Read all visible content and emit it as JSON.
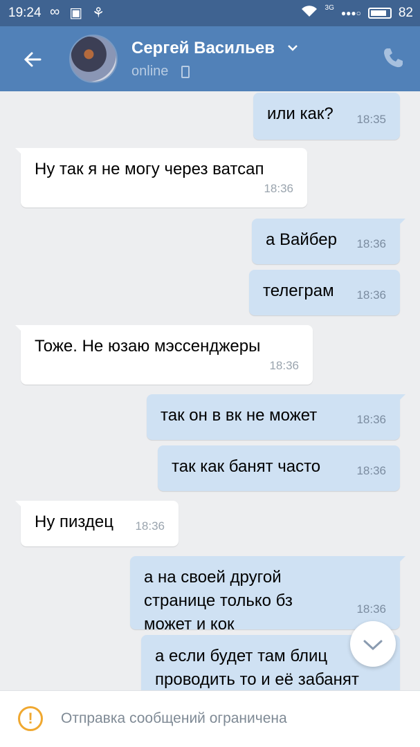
{
  "status_bar": {
    "time": "19:24",
    "battery": "82",
    "network": "3G"
  },
  "header": {
    "contact_name": "Сергей Васильев",
    "status": "online"
  },
  "messages": [
    {
      "dir": "out",
      "text": "или как?",
      "time": "18:35"
    },
    {
      "dir": "in",
      "text": "Ну так я не могу через ватсап",
      "time": "18:36"
    },
    {
      "dir": "out",
      "text": "а Вайбер",
      "time": "18:36"
    },
    {
      "dir": "out",
      "text": "телеграм",
      "time": "18:36"
    },
    {
      "dir": "in",
      "text": "Тоже.  Не юзаю мэссенджеры",
      "time": "18:36"
    },
    {
      "dir": "out",
      "text": "так он в вк не может",
      "time": "18:36"
    },
    {
      "dir": "out",
      "text": "так как банят часто",
      "time": "18:36"
    },
    {
      "dir": "in",
      "text": "Ну пиздец",
      "time": "18:36"
    },
    {
      "dir": "out",
      "text": "а на своей другой странице только бз может и кок",
      "time": "18:36"
    },
    {
      "dir": "out",
      "text": "а если будет там блиц проводить то и её забанят",
      "time": ""
    }
  ],
  "footer": {
    "restricted_text": "Отправка сообщений ограничена"
  },
  "colors": {
    "header_bg": "#5181b8",
    "statusbar_bg": "#3f6391",
    "outgoing_bubble": "#cfe1f3",
    "incoming_bubble": "#ffffff",
    "warning": "#f0a830"
  }
}
